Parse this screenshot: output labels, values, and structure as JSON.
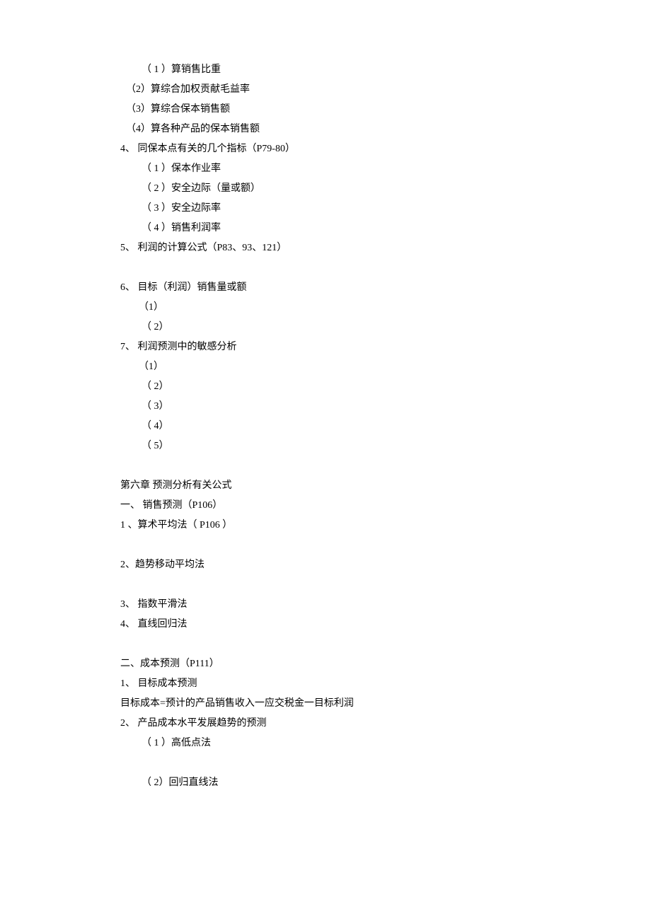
{
  "lines": [
    {
      "cls": "indent-2",
      "text": "（ 1 ）算销售比重"
    },
    {
      "cls": "indent-0",
      "text": "（2）算综合加权贡献毛益率"
    },
    {
      "cls": "indent-0",
      "text": "（3）算综合保本销售额"
    },
    {
      "cls": "indent-0",
      "text": "（4）算各种产品的保本销售额"
    },
    {
      "cls": "indent-1",
      "text": "4、 同保本点有关的几个指标（P79-80）"
    },
    {
      "cls": "indent-2",
      "text": "（ 1 ）保本作业率"
    },
    {
      "cls": "indent-2",
      "text": "（ 2 ）安全边际（量或额）"
    },
    {
      "cls": "indent-2",
      "text": "（ 3 ）安全边际率"
    },
    {
      "cls": "indent-2",
      "text": "（ 4 ）销售利润率"
    },
    {
      "cls": "indent-1",
      "text": "5、 利润的计算公式（P83、93、121）"
    },
    {
      "cls": "blank",
      "text": ""
    },
    {
      "cls": "indent-1",
      "text": "6、 目标（利润）销售量或额"
    },
    {
      "cls": "indent-2b",
      "text": "（1）"
    },
    {
      "cls": "indent-2",
      "text": "（ 2）"
    },
    {
      "cls": "indent-1",
      "text": "7、 利润预测中的敏感分析"
    },
    {
      "cls": "indent-2b",
      "text": "（1）"
    },
    {
      "cls": "indent-2",
      "text": "（ 2）"
    },
    {
      "cls": "indent-2",
      "text": "（ 3）"
    },
    {
      "cls": "indent-2",
      "text": "（ 4）"
    },
    {
      "cls": "indent-2",
      "text": "（ 5）"
    },
    {
      "cls": "blank",
      "text": ""
    },
    {
      "cls": "indent-1",
      "text": "第六章 预测分析有关公式"
    },
    {
      "cls": "indent-1",
      "text": "一、 销售预测（P106）"
    },
    {
      "cls": "indent-1",
      "text": "1 、算术平均法（ P106 ）"
    },
    {
      "cls": "blank",
      "text": ""
    },
    {
      "cls": "indent-1",
      "text": "2、趋势移动平均法"
    },
    {
      "cls": "blank",
      "text": ""
    },
    {
      "cls": "indent-1",
      "text": "3、 指数平滑法"
    },
    {
      "cls": "indent-1",
      "text": "4、 直线回归法"
    },
    {
      "cls": "blank",
      "text": ""
    },
    {
      "cls": "indent-1",
      "text": "二、成本预测（P111）"
    },
    {
      "cls": "indent-1",
      "text": "1、 目标成本预测"
    },
    {
      "cls": "indent-1",
      "text": "目标成本=预计的产品销售收入一应交税金一目标利润"
    },
    {
      "cls": "indent-1",
      "text": "2、 产品成本水平发展趋势的预测"
    },
    {
      "cls": "indent-2",
      "text": "（ 1 ）高低点法"
    },
    {
      "cls": "blank",
      "text": ""
    },
    {
      "cls": "indent-2",
      "text": "（ 2）回归直线法"
    }
  ]
}
